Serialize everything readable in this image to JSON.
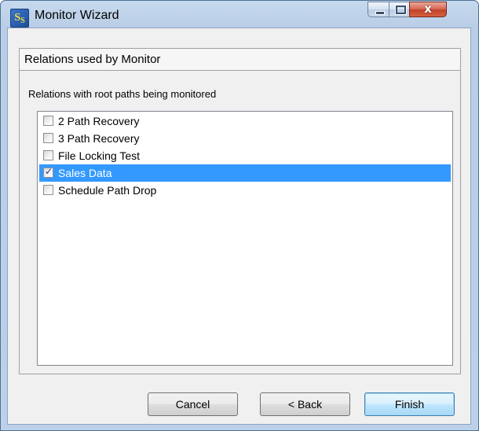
{
  "window": {
    "title": "Monitor Wizard",
    "icon_text": "S",
    "icon_sub": "S"
  },
  "title_controls": {
    "minimize": "minimize-icon",
    "maximize": "maximize-icon",
    "close": "x"
  },
  "section": {
    "title": "Relations used by Monitor",
    "caption": "Relations with root paths being monitored"
  },
  "relations": [
    {
      "label": "2 Path Recovery",
      "checked": false,
      "selected": false
    },
    {
      "label": "3 Path Recovery",
      "checked": false,
      "selected": false
    },
    {
      "label": "File Locking Test",
      "checked": false,
      "selected": false
    },
    {
      "label": "Sales Data",
      "checked": true,
      "selected": true
    },
    {
      "label": "Schedule Path Drop",
      "checked": false,
      "selected": false
    }
  ],
  "check_glyph": "✓",
  "buttons": {
    "cancel": "Cancel",
    "back": "< Back",
    "finish": "Finish"
  },
  "colors": {
    "selection": "#3399ff",
    "close_button": "#c7432c"
  }
}
